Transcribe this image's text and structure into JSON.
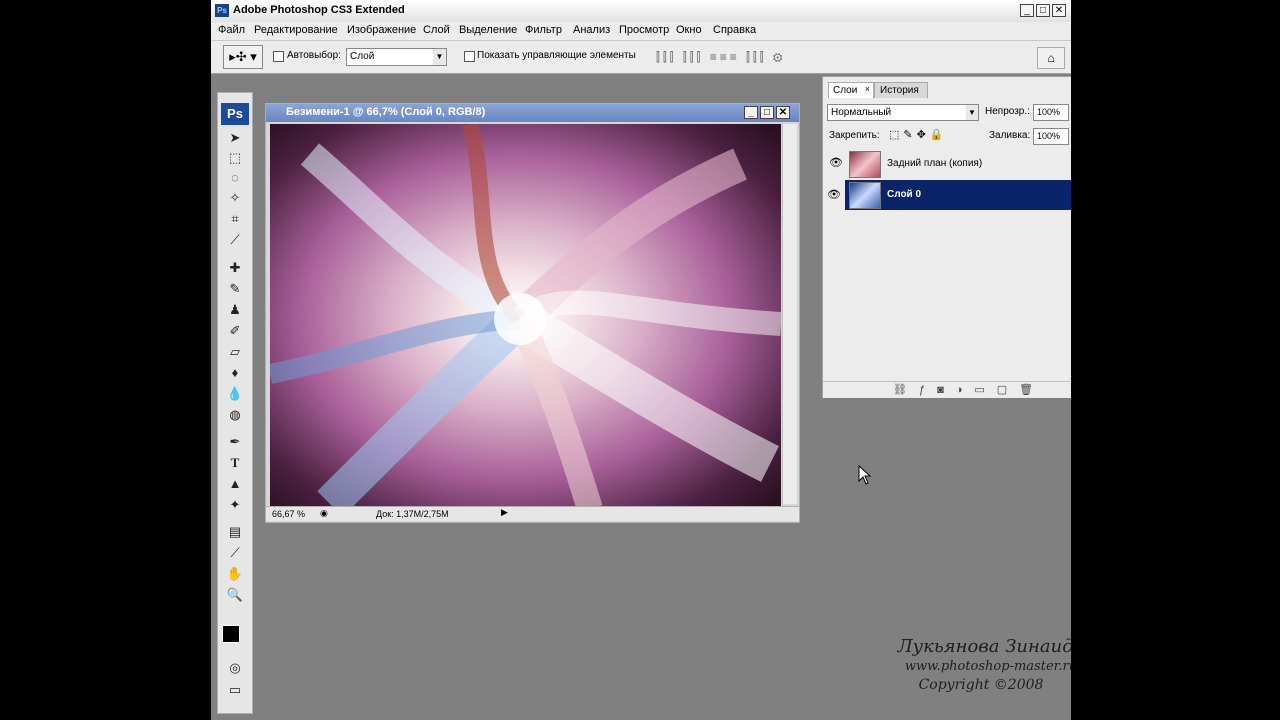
{
  "app": {
    "title": "Adobe Photoshop CS3 Extended",
    "logo_text": "Ps",
    "toolbox_logo": "Ps"
  },
  "menu": [
    "Файл",
    "Редактирование",
    "Изображение",
    "Слой",
    "Выделение",
    "Фильтр",
    "Анализ",
    "Просмотр",
    "Окно",
    "Справка"
  ],
  "options": {
    "autoselect_label": "Автовыбор:",
    "autoselect_value": "Слой",
    "show_controls_label": "Показать управляющие элементы"
  },
  "document": {
    "title": "Безимени-1 @ 66,7% (Слой 0, RGB/8)",
    "zoom": "66,67 %",
    "doc_info": "Док: 1,37M/2,75M"
  },
  "panel": {
    "tabs": [
      "Слои",
      "История"
    ],
    "blend_mode": "Нормальный",
    "opacity_label": "Непрозр.:",
    "opacity_value": "100%",
    "lock_label": "Закрепить:",
    "fill_label": "Заливка:",
    "fill_value": "100%",
    "layers": [
      {
        "name": "Задний план (копия)",
        "selected": false
      },
      {
        "name": "Слой 0",
        "selected": true
      }
    ]
  },
  "watermark": {
    "author": "Лукьянова Зинаида",
    "site": "www.photoshop-master.ru",
    "copyright": "Copyright ©2008"
  },
  "colors": {
    "selection": "#0b2469",
    "workspace": "#808080"
  }
}
